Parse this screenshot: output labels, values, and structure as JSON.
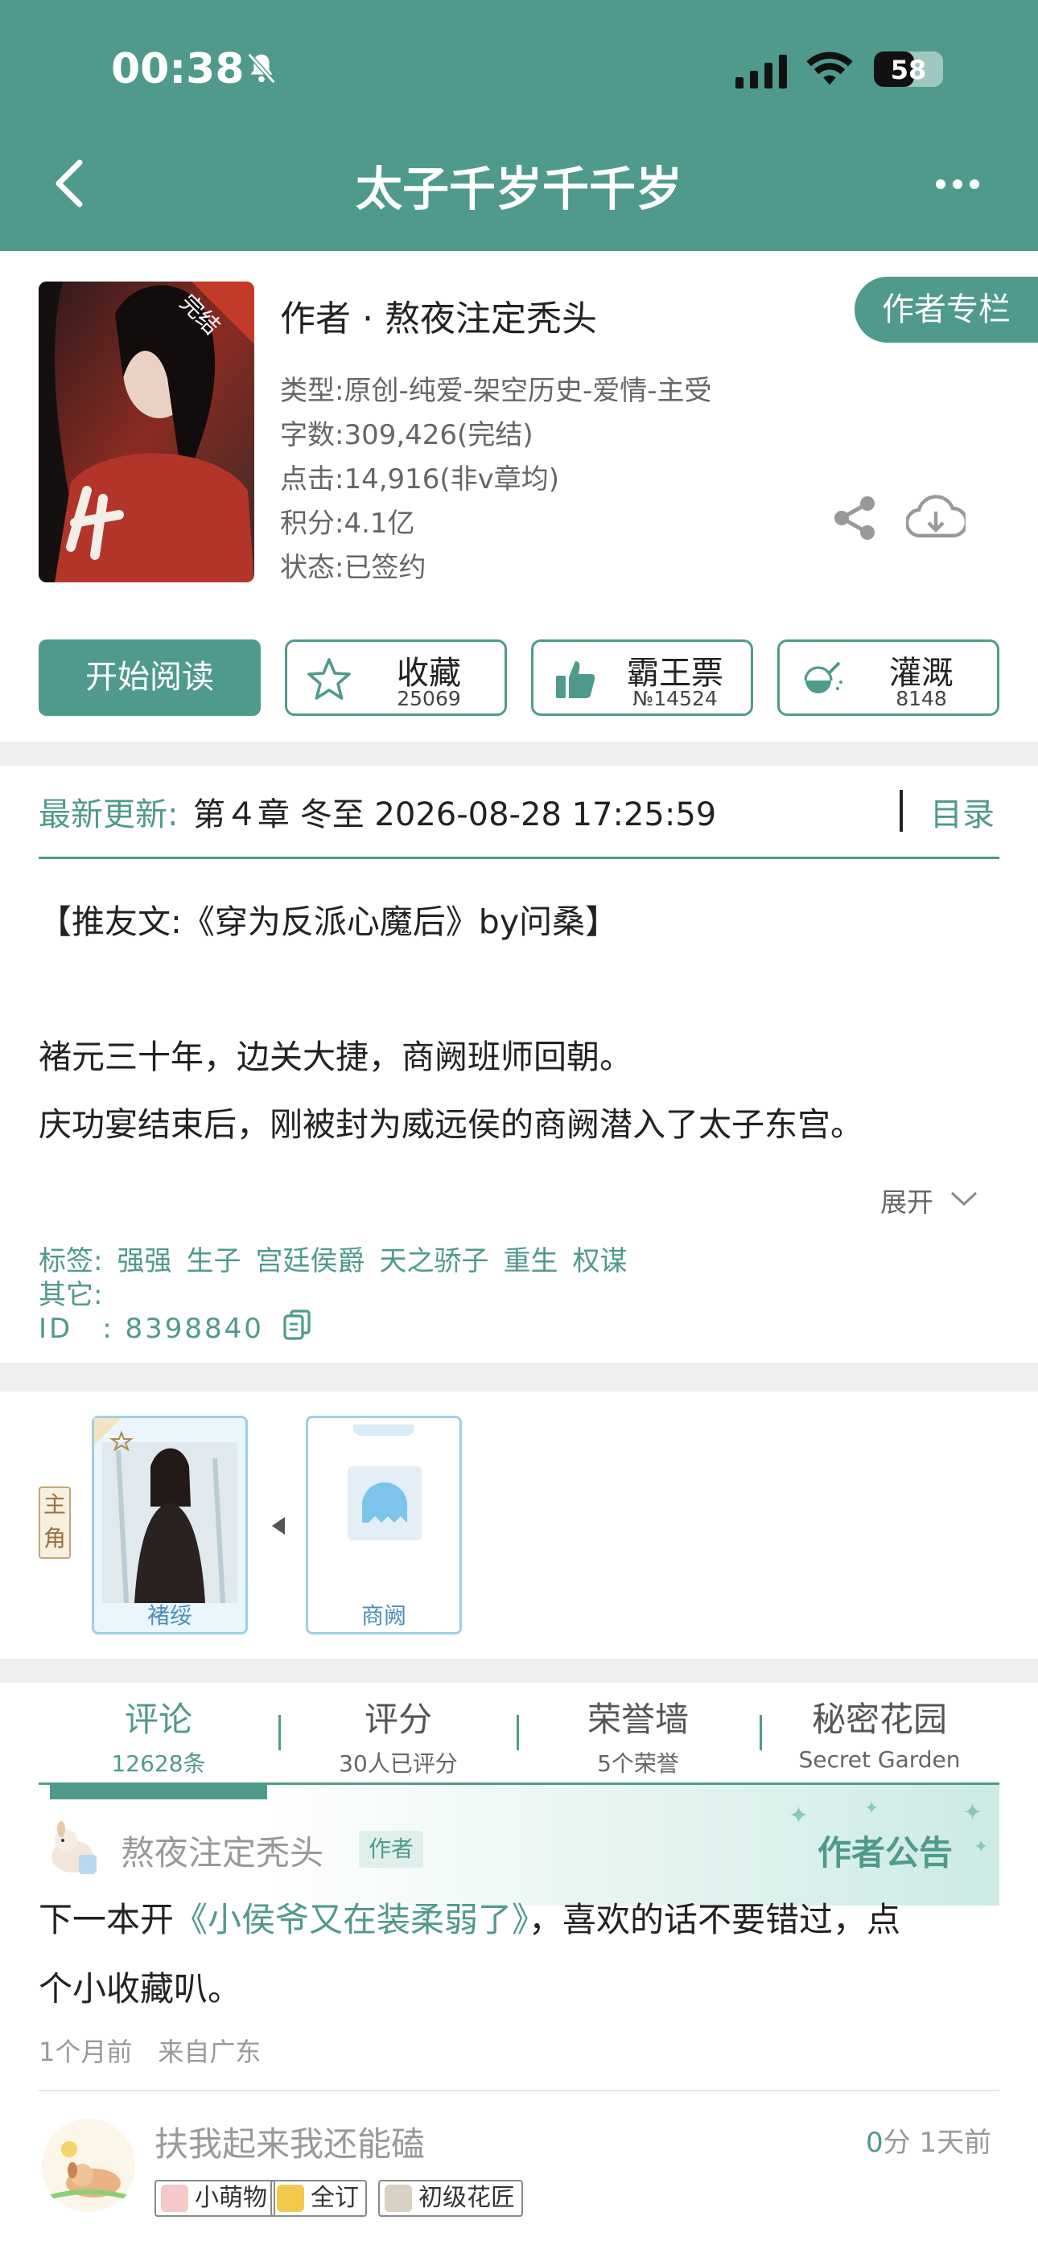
{
  "status": {
    "time": "00:38",
    "battery": "58",
    "battery_level": 0.58
  },
  "header": {
    "title": "太子千岁千千岁"
  },
  "book": {
    "author_line": "作者 · 熬夜注定秃头",
    "author_column_label": "作者专栏",
    "cover_badge": "完结",
    "meta": [
      "类型:原创-纯爱-架空历史-爱情-主受",
      "字数:309,426(完结)",
      "点击:14,916(非v章均)",
      "积分:4.1亿",
      "状态:已签约"
    ]
  },
  "actions": {
    "read_label": "开始阅读",
    "collect": {
      "label": "收藏",
      "count": "25069"
    },
    "vote": {
      "label": "霸王票",
      "count": "№14524"
    },
    "water": {
      "label": "灌溉",
      "count": "8148"
    }
  },
  "latest": {
    "label": "最新更新:",
    "text": "第４章 冬至 2026-08-28 17:25:59",
    "toc_label": "目录"
  },
  "description": {
    "lines": [
      "【推友文:《穿为反派心魔后》by问桑】",
      "褚元三十年，边关大捷，商阙班师回朝。",
      "庆功宴结束后，刚被封为威远侯的商阙潜入了太子东宫。"
    ],
    "expand_label": "展开"
  },
  "tags": {
    "label": "标签:",
    "items": [
      "强强",
      "生子",
      "宫廷侯爵",
      "天之骄子",
      "重生",
      "权谋"
    ],
    "other_label": "其它:",
    "id_label": "ID　:",
    "id_value": "8398840"
  },
  "characters": {
    "role_label": "主角",
    "items": [
      {
        "name": "褚绥"
      },
      {
        "name": "商阙"
      }
    ]
  },
  "tabs": [
    {
      "title": "评论",
      "sub": "12628条"
    },
    {
      "title": "评分",
      "sub": "30人已评分"
    },
    {
      "title": "荣誉墙",
      "sub": "5个荣誉"
    },
    {
      "title": "秘密花园",
      "sub": "Secret Garden"
    }
  ],
  "comments": {
    "pinned": {
      "name": "熬夜注定秃头",
      "badge": "作者",
      "notice_title": "作者公告",
      "text_pre": "下一本开",
      "text_link": "《小侯爷又在装柔弱了》",
      "text_post_line1": "，喜欢的话不要错过，点",
      "text_line2": "个小收藏叭。",
      "time": "1个月前",
      "location": "来自广东"
    },
    "next": {
      "name": "扶我起来我还能磕",
      "score_num": "0",
      "score_unit": "分",
      "time": "1天前",
      "badges": [
        "小萌物",
        "全订",
        "初级花匠"
      ]
    }
  },
  "colors": {
    "primary": "#4f9a8d",
    "text": "#222222",
    "muted": "#999999"
  },
  "icons": [
    "back-icon",
    "more-icon",
    "bell-slash-icon",
    "signal-icon",
    "wifi-icon",
    "share-icon",
    "download-icon",
    "star-icon",
    "thumbs-up-icon",
    "watering-can-icon",
    "chevron-down-icon",
    "copy-icon"
  ]
}
